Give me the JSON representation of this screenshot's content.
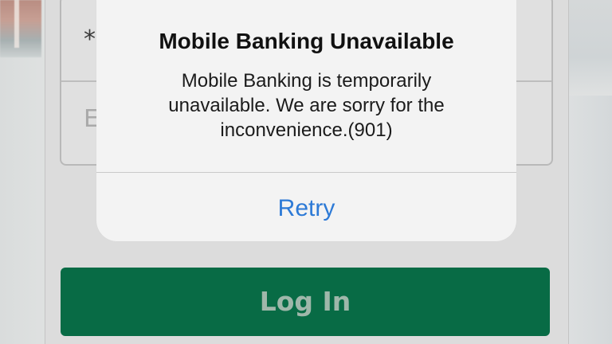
{
  "login_form": {
    "password_value": "*",
    "email_placeholder": "E",
    "login_button_label": "Log In"
  },
  "alert": {
    "title": "Mobile Banking Unavailable",
    "message_line1": "Mobile Banking is temporarily",
    "message_line2": "unavailable. We are sorry for the",
    "message_line3": "inconvenience.(901)",
    "action_label": "Retry"
  },
  "colors": {
    "login_button": "#086b45",
    "alert_action": "#2d7ad6",
    "alert_background": "#f3f3f3"
  }
}
